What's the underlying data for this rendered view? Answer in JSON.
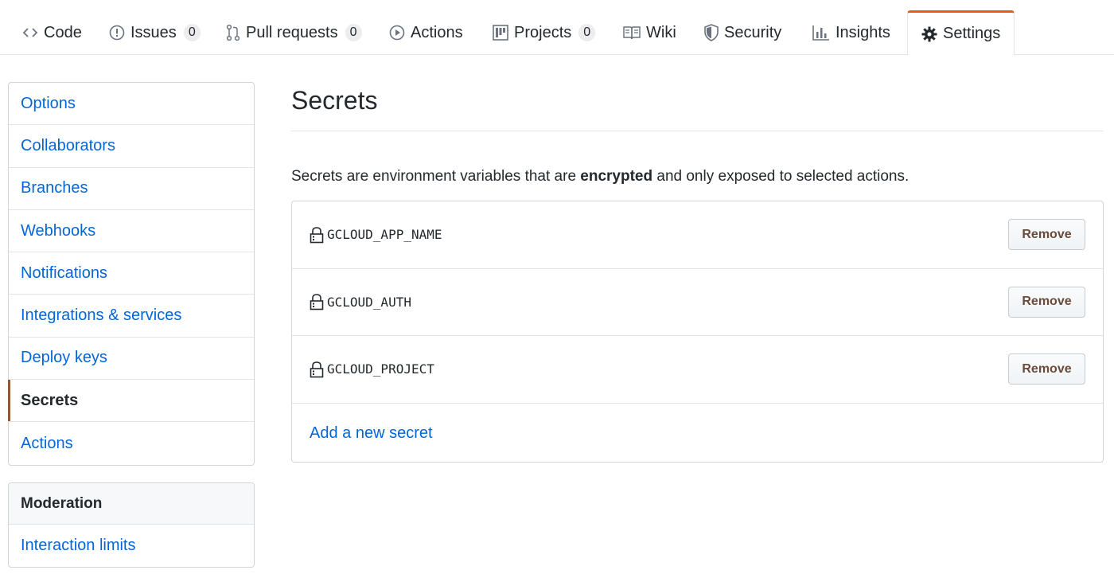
{
  "repo_nav": {
    "tabs": [
      {
        "label": "Code",
        "icon": "code-icon",
        "counter": null
      },
      {
        "label": "Issues",
        "icon": "issue-icon",
        "counter": "0"
      },
      {
        "label": "Pull requests",
        "icon": "pull-request-icon",
        "counter": "0"
      },
      {
        "label": "Actions",
        "icon": "play-icon",
        "counter": null
      },
      {
        "label": "Projects",
        "icon": "project-icon",
        "counter": "0"
      },
      {
        "label": "Wiki",
        "icon": "book-icon",
        "counter": null
      },
      {
        "label": "Security",
        "icon": "shield-icon",
        "counter": null
      },
      {
        "label": "Insights",
        "icon": "graph-icon",
        "counter": null
      },
      {
        "label": "Settings",
        "icon": "gear-icon",
        "counter": null,
        "selected": true
      }
    ]
  },
  "sidebar": {
    "items": [
      {
        "label": "Options"
      },
      {
        "label": "Collaborators"
      },
      {
        "label": "Branches"
      },
      {
        "label": "Webhooks"
      },
      {
        "label": "Notifications"
      },
      {
        "label": "Integrations & services"
      },
      {
        "label": "Deploy keys"
      },
      {
        "label": "Secrets",
        "selected": true
      },
      {
        "label": "Actions"
      }
    ],
    "moderation": {
      "heading": "Moderation",
      "items": [
        {
          "label": "Interaction limits"
        }
      ]
    }
  },
  "main": {
    "title": "Secrets",
    "description_before": "Secrets are environment variables that are ",
    "description_bold": "encrypted",
    "description_after": " and only exposed to selected actions.",
    "secrets": [
      {
        "name": "GCLOUD_APP_NAME",
        "action_label": "Remove"
      },
      {
        "name": "GCLOUD_AUTH",
        "action_label": "Remove"
      },
      {
        "name": "GCLOUD_PROJECT",
        "action_label": "Remove"
      }
    ],
    "add_link": "Add a new secret"
  },
  "colors": {
    "link": "#0366d6",
    "text": "#24292e",
    "selected_tab_accent": "#e36209",
    "border": "#e1e4e8"
  }
}
